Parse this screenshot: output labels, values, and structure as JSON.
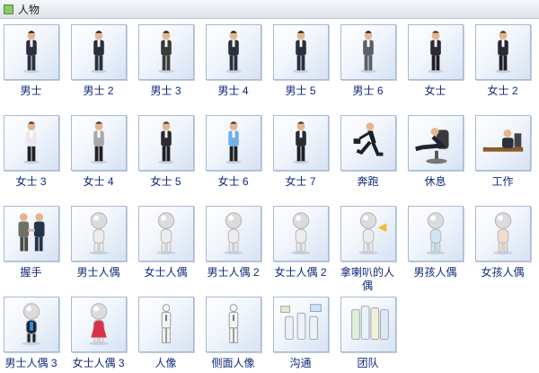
{
  "panel": {
    "title": "人物",
    "title_icon": "green-square-icon"
  },
  "colors": {
    "label_text": "#10297a",
    "tile_border": "#a9b9d1"
  },
  "items": [
    {
      "label": "男士",
      "icon": "businessman-icon",
      "kind": "man"
    },
    {
      "label": "男士 2",
      "icon": "businessman-icon",
      "kind": "man"
    },
    {
      "label": "男士 3",
      "icon": "businessman-icon",
      "kind": "man-light"
    },
    {
      "label": "男士 4",
      "icon": "businessman-icon",
      "kind": "man"
    },
    {
      "label": "男士 5",
      "icon": "businessman-icon",
      "kind": "man"
    },
    {
      "label": "男士 6",
      "icon": "businessman-icon",
      "kind": "man-grey"
    },
    {
      "label": "女士",
      "icon": "businesswoman-icon",
      "kind": "woman-dark"
    },
    {
      "label": "女士 2",
      "icon": "businesswoman-icon",
      "kind": "woman-dark"
    },
    {
      "label": "女士 3",
      "icon": "businesswoman-icon",
      "kind": "woman-light"
    },
    {
      "label": "女士 4",
      "icon": "businesswoman-icon",
      "kind": "woman-grey"
    },
    {
      "label": "女士 5",
      "icon": "businesswoman-icon",
      "kind": "woman-dark"
    },
    {
      "label": "女士 6",
      "icon": "businesswoman-icon",
      "kind": "woman-blue"
    },
    {
      "label": "女士 7",
      "icon": "businesswoman-icon",
      "kind": "woman-dark"
    },
    {
      "label": "奔跑",
      "icon": "running-man-icon",
      "kind": "running"
    },
    {
      "label": "休息",
      "icon": "resting-man-icon",
      "kind": "resting"
    },
    {
      "label": "工作",
      "icon": "working-man-icon",
      "kind": "working"
    },
    {
      "label": "握手",
      "icon": "handshake-icon",
      "kind": "handshake"
    },
    {
      "label": "男士人偶",
      "icon": "male-figure-icon",
      "kind": "puppet"
    },
    {
      "label": "女士人偶",
      "icon": "female-figure-icon",
      "kind": "puppet"
    },
    {
      "label": "男士人偶 2",
      "icon": "male-figure-icon",
      "kind": "puppet"
    },
    {
      "label": "女士人偶 2",
      "icon": "female-figure-icon",
      "kind": "puppet"
    },
    {
      "label": "拿喇叭的人偶",
      "icon": "megaphone-figure-icon",
      "kind": "puppet-horn"
    },
    {
      "label": "男孩人偶",
      "icon": "boy-figure-icon",
      "kind": "puppet-boy"
    },
    {
      "label": "女孩人偶",
      "icon": "girl-figure-icon",
      "kind": "puppet-girl"
    },
    {
      "label": "男士人偶 3",
      "icon": "male-figure-suit-icon",
      "kind": "puppet-suit"
    },
    {
      "label": "女士人偶 3",
      "icon": "female-figure-dress-icon",
      "kind": "puppet-dress"
    },
    {
      "label": "人像",
      "icon": "person-outline-icon",
      "kind": "outline"
    },
    {
      "label": "侧面人像",
      "icon": "person-side-outline-icon",
      "kind": "outline"
    },
    {
      "label": "沟通",
      "icon": "communication-icon",
      "kind": "comm"
    },
    {
      "label": "团队",
      "icon": "team-icon",
      "kind": "team"
    }
  ]
}
